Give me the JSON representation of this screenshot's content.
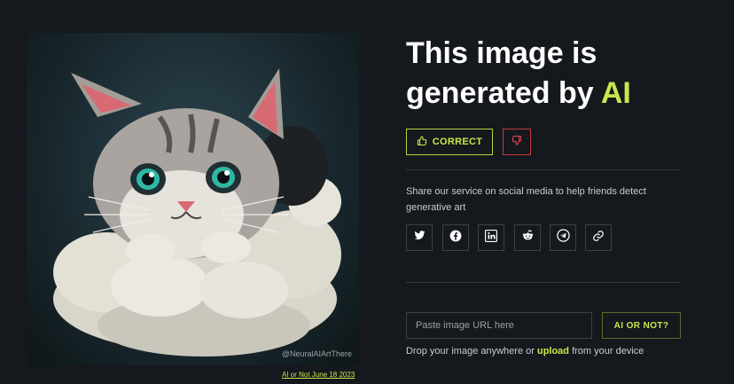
{
  "image": {
    "watermark": "@NeuralAIArtThere",
    "caption": "AI or Not June 18 2023"
  },
  "result": {
    "headline_prefix": "This image is generated by ",
    "headline_accent": "AI"
  },
  "feedback": {
    "correct_label": "CORRECT",
    "correct_icon": "thumbs-up-icon",
    "wrong_icon": "thumbs-down-icon"
  },
  "share": {
    "text": "Share our service on social media to help friends detect generative art",
    "icons": [
      "twitter-icon",
      "facebook-icon",
      "linkedin-icon",
      "reddit-icon",
      "telegram-icon",
      "link-icon"
    ]
  },
  "check": {
    "url_placeholder": "Paste image URL here",
    "button_label": "AI OR NOT?",
    "drop_prefix": "Drop your image anywhere or ",
    "upload_label": "upload",
    "drop_suffix": " from your device"
  },
  "colors": {
    "background": "#15181d",
    "accent": "#c7e84a",
    "danger": "#c23d3d",
    "border": "#3b4048"
  }
}
